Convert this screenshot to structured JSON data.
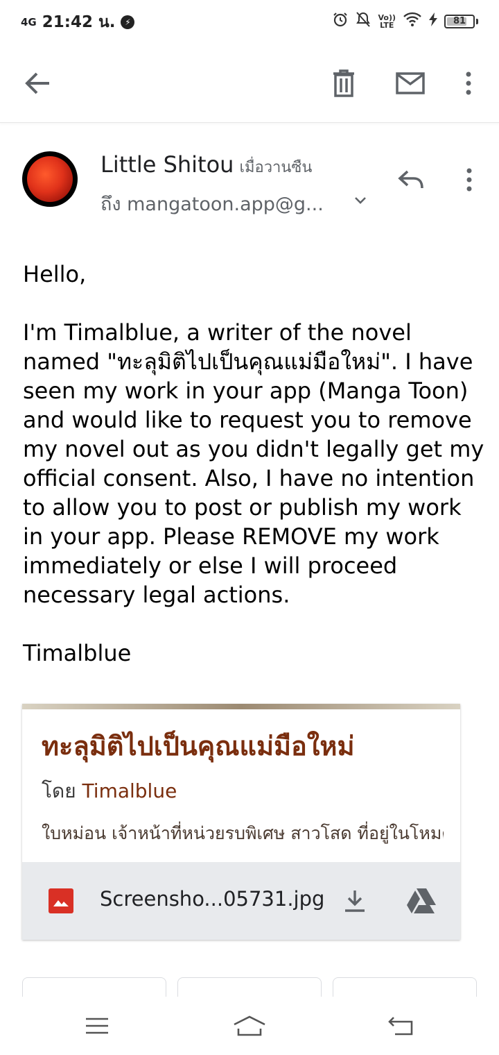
{
  "status_bar": {
    "network": "4G",
    "time": "21:42 น.",
    "volte_line1": "Vo))",
    "volte_line2": "LTE",
    "battery": "81",
    "battery_level": 0.81
  },
  "toolbar": {
    "back_icon": "arrow-left-icon",
    "delete_icon": "trash-icon",
    "mail_icon": "mail-icon",
    "more_icon": "more-vertical-icon"
  },
  "email": {
    "sender_name": "Little Shitou",
    "time": "เมื่อวานซืน",
    "recipient": "ถึง mangatoon.app@g...",
    "greeting": "Hello,",
    "body": "I'm Timalblue, a writer of the novel named \"ทะลุมิติไปเป็นคุณแม่มือใหม่\". I have seen my work in your app (Manga Toon) and would like to request you to remove my novel out as you didn't legally get my official consent. Also, I have no intention to allow you to post or publish my work in your app. Please REMOVE my work immediately or else I will proceed necessary legal actions.",
    "signature": "Timalblue"
  },
  "attachment": {
    "preview_title": "ทะลุมิติไปเป็นคุณแม่มือใหม่",
    "preview_by": "โดย",
    "preview_author": "Timalblue",
    "preview_desc": "ใบหม่อน เจ้าหน้าที่หน่วยรบพิเศษ สาวโสด ที่อยู่ในโหมดอยากมีแฟน ชอบอ่านนิยาย",
    "file_name": "Screensho...05731.jpg"
  },
  "colors": {
    "accent_title": "#7a2e0e",
    "icon_gray": "#5f6368",
    "attachment_bar": "#e8eaed",
    "image_icon": "#d93025"
  }
}
